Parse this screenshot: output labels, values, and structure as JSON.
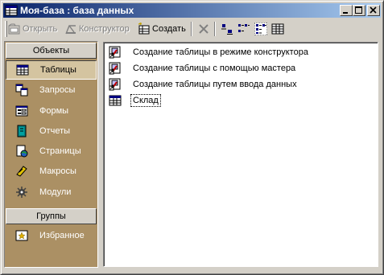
{
  "window": {
    "title": "Моя-база : база данных",
    "controls": {
      "minimize": "minimize",
      "maximize": "maximize",
      "close": "close"
    }
  },
  "toolbar": {
    "open_label": "Открыть",
    "design_label": "Конструктор",
    "create_label": "Создать",
    "open_enabled": false,
    "design_enabled": false,
    "create_enabled": true,
    "view_buttons": [
      "delete-icon",
      "large-icons-view-icon",
      "small-icons-view-icon",
      "list-view-icon",
      "details-view-icon"
    ]
  },
  "outlook": {
    "objects_header": "Объекты",
    "groups_header": "Группы",
    "items": [
      {
        "label": "Таблицы",
        "icon": "table-icon",
        "selected": true
      },
      {
        "label": "Запросы",
        "icon": "query-icon",
        "selected": false
      },
      {
        "label": "Формы",
        "icon": "form-icon",
        "selected": false
      },
      {
        "label": "Отчеты",
        "icon": "report-icon",
        "selected": false
      },
      {
        "label": "Страницы",
        "icon": "page-icon",
        "selected": false
      },
      {
        "label": "Макросы",
        "icon": "macro-icon",
        "selected": false
      },
      {
        "label": "Модули",
        "icon": "module-icon",
        "selected": false
      }
    ],
    "groups": [
      {
        "label": "Избранное",
        "icon": "favorites-icon"
      }
    ]
  },
  "list": {
    "items": [
      {
        "label": "Создание таблицы в режиме конструктора",
        "icon": "wizard-shortcut-icon"
      },
      {
        "label": "Создание таблицы с помощью мастера",
        "icon": "wizard-shortcut-icon"
      },
      {
        "label": "Создание таблицы путем ввода данных",
        "icon": "wizard-shortcut-icon"
      },
      {
        "label": "Склад",
        "icon": "table-icon",
        "focused": true
      }
    ]
  },
  "colors": {
    "titlebar_start": "#0a246a",
    "titlebar_end": "#a6caf0",
    "outlook_bg": "#ab9064",
    "face": "#d4d0c8"
  }
}
